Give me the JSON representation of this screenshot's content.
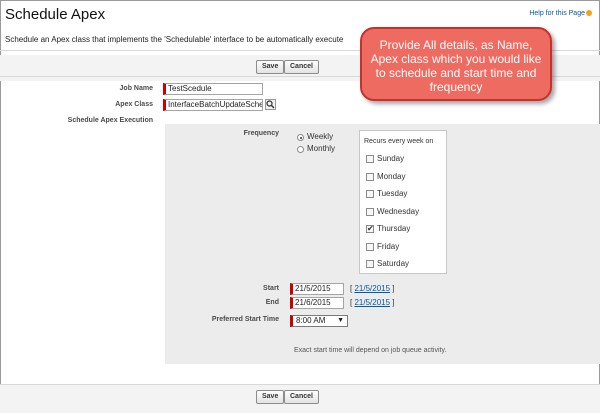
{
  "page": {
    "title": "Schedule Apex",
    "help_link": "Help for this Page",
    "description": "Schedule an Apex class that implements the 'Schedulable' interface to be automatically execute"
  },
  "buttons": {
    "save": "Save",
    "cancel": "Cancel"
  },
  "form": {
    "job_name_label": "Job Name",
    "job_name_value": "TestScedule",
    "apex_class_label": "Apex Class",
    "apex_class_value": "InterfaceBatchUpdateSche",
    "schedule_label": "Schedule Apex Execution"
  },
  "frequency": {
    "label": "Frequency",
    "options": [
      "Weekly",
      "Monthly"
    ],
    "selected": "Weekly",
    "recurs_label": "Recurs every week on",
    "days": [
      {
        "name": "Sunday",
        "checked": false
      },
      {
        "name": "Monday",
        "checked": false
      },
      {
        "name": "Tuesday",
        "checked": false
      },
      {
        "name": "Wednesday",
        "checked": false
      },
      {
        "name": "Thursday",
        "checked": true
      },
      {
        "name": "Friday",
        "checked": false
      },
      {
        "name": "Saturday",
        "checked": false
      }
    ]
  },
  "dates": {
    "start_label": "Start",
    "start_value": "21/5/2015",
    "start_link": "21/5/2015",
    "end_label": "End",
    "end_value": "21/6/2015",
    "end_link": "21/5/2015",
    "time_label": "Preferred Start Time",
    "time_value": "8:00 AM"
  },
  "note": "Exact start time will depend on job queue activity.",
  "callout": "Provide All details, as Name, Apex class which you would like to schedule and start time and frequency"
}
